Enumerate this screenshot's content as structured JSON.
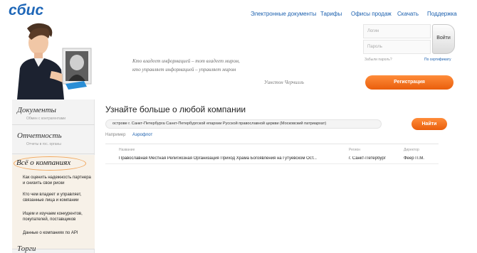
{
  "header": {
    "logo": "сбис",
    "nav": [
      {
        "label": "Электронные документы"
      },
      {
        "label": "Тарифы"
      },
      {
        "label": "Офисы продаж"
      },
      {
        "label": "Скачать"
      },
      {
        "label": "Поддержка"
      }
    ]
  },
  "hero": {
    "quote_line1": "Кто владеет информацией – тот владеет миром,",
    "quote_line2": "кто управляет информацией – управляет миром",
    "author": "Уинстон Черчилль"
  },
  "login": {
    "login_placeholder": "Логин",
    "password_placeholder": "Пароль",
    "login_button": "Войти",
    "forgot_link": "Забыли пароль?",
    "cert_link": "По сертификату",
    "register_button": "Регистрация"
  },
  "sidebar": {
    "sections": [
      {
        "title": "Документы",
        "subtitle": "Обмен с контрагентами"
      },
      {
        "title": "Отчетность",
        "subtitle": "Отчеты в гос. органы"
      },
      {
        "title": "Всё о компаниях",
        "subtitle": ""
      },
      {
        "title": "Торги",
        "subtitle": ""
      }
    ],
    "links": [
      {
        "label": "Как оценить надежность партнера и снизить свои риски"
      },
      {
        "label": "Кто чем владеет и управляет, связанные лица и компании"
      },
      {
        "label": "Ищем и изучаем конкурентов, покупателей, поставщиков"
      },
      {
        "label": "Данные о компаниях по API"
      }
    ]
  },
  "main": {
    "title": "Узнайте больше о любой компании",
    "search_value": "острове г. Санкт-Петербурга Санкт-Петербургской епархии Русской православной церкви (Московский патриархат)",
    "search_button": "Найти",
    "example_label": "Например",
    "example_value": "Аэрофлот",
    "columns": {
      "name": "Название",
      "region": "Регион",
      "director": "Директор"
    },
    "rows": [
      {
        "name": "Православная Местная Религиозная Организация Приход Храма Богоявления на Гутуевском Ост...",
        "region": "г. Санкт-Петербург",
        "director": "Феер П.М."
      }
    ]
  },
  "colors": {
    "accent": "#ef6a1a",
    "link": "#1a5fae",
    "logo": "#1f67b8"
  }
}
